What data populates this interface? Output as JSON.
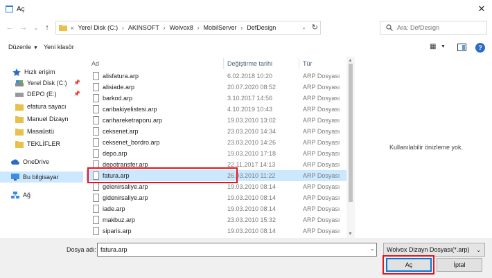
{
  "window": {
    "title": "Aç",
    "close_glyph": "✕"
  },
  "nav": {
    "back_glyph": "←",
    "forward_glyph": "→",
    "recent_glyph": "⌄",
    "up_glyph": "↑",
    "overflow": "«",
    "breadcrumb": [
      "Yerel Disk (C:)",
      "AKINSOFT",
      "Wolvox8",
      "MobilServer",
      "DefDesign"
    ],
    "separator": "›",
    "search_placeholder": "Ara: DefDesign"
  },
  "command_bar": {
    "organize_label": "Düzenle",
    "new_folder_label": "Yeni klasör"
  },
  "sidebar": {
    "items": [
      {
        "label": "Hızlı erişim",
        "icon": "star-icon"
      },
      {
        "label": "Yerel Disk (C:)",
        "icon": "drive-icon"
      },
      {
        "label": "DEPO (E:)",
        "icon": "drive-icon"
      },
      {
        "label": "efatura sayacı",
        "icon": "folder-icon"
      },
      {
        "label": "Manuel Dizayn",
        "icon": "folder-icon"
      },
      {
        "label": "Masaüstü",
        "icon": "folder-icon"
      },
      {
        "label": "TEKLİFLER",
        "icon": "folder-icon"
      },
      {
        "label": "OneDrive",
        "icon": "cloud-icon"
      },
      {
        "label": "Bu bilgisayar",
        "icon": "computer-icon"
      },
      {
        "label": "Ağ",
        "icon": "network-icon"
      }
    ]
  },
  "file_list": {
    "columns": {
      "name": "Ad",
      "date": "Değiştirme tarihi",
      "type": "Tür"
    },
    "rows": [
      {
        "name": "alisfatura.arp",
        "date": "6.02.2018 10:20",
        "type": "ARP Dosyası"
      },
      {
        "name": "alisiade.arp",
        "date": "20.07.2020 08:52",
        "type": "ARP Dosyası"
      },
      {
        "name": "barkod.arp",
        "date": "3.10.2017 14:56",
        "type": "ARP Dosyası"
      },
      {
        "name": "caribakiyelistesi.arp",
        "date": "4.10.2019 10:43",
        "type": "ARP Dosyası"
      },
      {
        "name": "carihareketraporu.arp",
        "date": "19.03.2010 13:02",
        "type": "ARP Dosyası"
      },
      {
        "name": "ceksenet.arp",
        "date": "23.03.2010 14:34",
        "type": "ARP Dosyası"
      },
      {
        "name": "ceksenet_bordro.arp",
        "date": "23.03.2010 14:26",
        "type": "ARP Dosyası"
      },
      {
        "name": "depo.arp",
        "date": "19.03.2010 17:18",
        "type": "ARP Dosyası"
      },
      {
        "name": "depotransfer.arp",
        "date": "22.11.2017 14:13",
        "type": "ARP Dosyası"
      },
      {
        "name": "fatura.arp",
        "date": "26.03.2010 11:22",
        "type": "ARP Dosyası"
      },
      {
        "name": "gelenirsaliye.arp",
        "date": "19.03.2010 08:14",
        "type": "ARP Dosyası"
      },
      {
        "name": "gidenirsaliye.arp",
        "date": "19.03.2010 08:14",
        "type": "ARP Dosyası"
      },
      {
        "name": "iade.arp",
        "date": "19.03.2010 08:14",
        "type": "ARP Dosyası"
      },
      {
        "name": "makbuz.arp",
        "date": "23.03.2010 15:32",
        "type": "ARP Dosyası"
      },
      {
        "name": "siparis.arp",
        "date": "19.03.2010 08:14",
        "type": "ARP Dosyası"
      }
    ]
  },
  "preview": {
    "message": "Kullanılabilir önizleme yok."
  },
  "footer": {
    "filename_label": "Dosya adı:",
    "filename_value": "fatura.arp",
    "filetype_value": "Wolvox Dizayn Dosyası(*.arp)",
    "open_label": "Aç",
    "cancel_label": "İptal"
  },
  "colors": {
    "accent": "#0078d7",
    "highlight": "#e8121b",
    "selection": "#cce8ff",
    "folder": "#e8c04a"
  }
}
